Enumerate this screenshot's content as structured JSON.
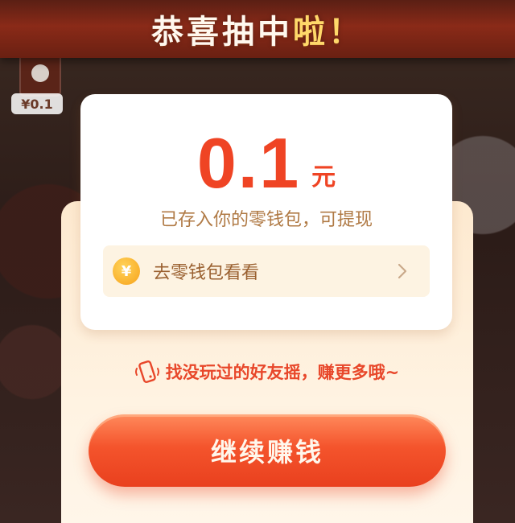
{
  "header": {
    "title_main": "恭喜抽中",
    "title_accent": "啦！"
  },
  "background": {
    "mini_card_label": "¥0.1"
  },
  "reward": {
    "amount": "0.1",
    "unit": "元",
    "saved_text": "已存入你的零钱包，可提现",
    "wallet_link": "去零钱包看看",
    "coin_symbol": "¥"
  },
  "invite": {
    "text": "找没玩过的好友摇，赚更多哦~"
  },
  "actions": {
    "continue_label": "继续赚钱"
  },
  "colors": {
    "accent": "#ef4424",
    "title_accent": "#ffd86a",
    "panel_bg": "#fde9cf",
    "muted_text": "#b07a45"
  },
  "icons": [
    "coin-icon",
    "chevron-right-icon",
    "phone-shake-icon"
  ]
}
